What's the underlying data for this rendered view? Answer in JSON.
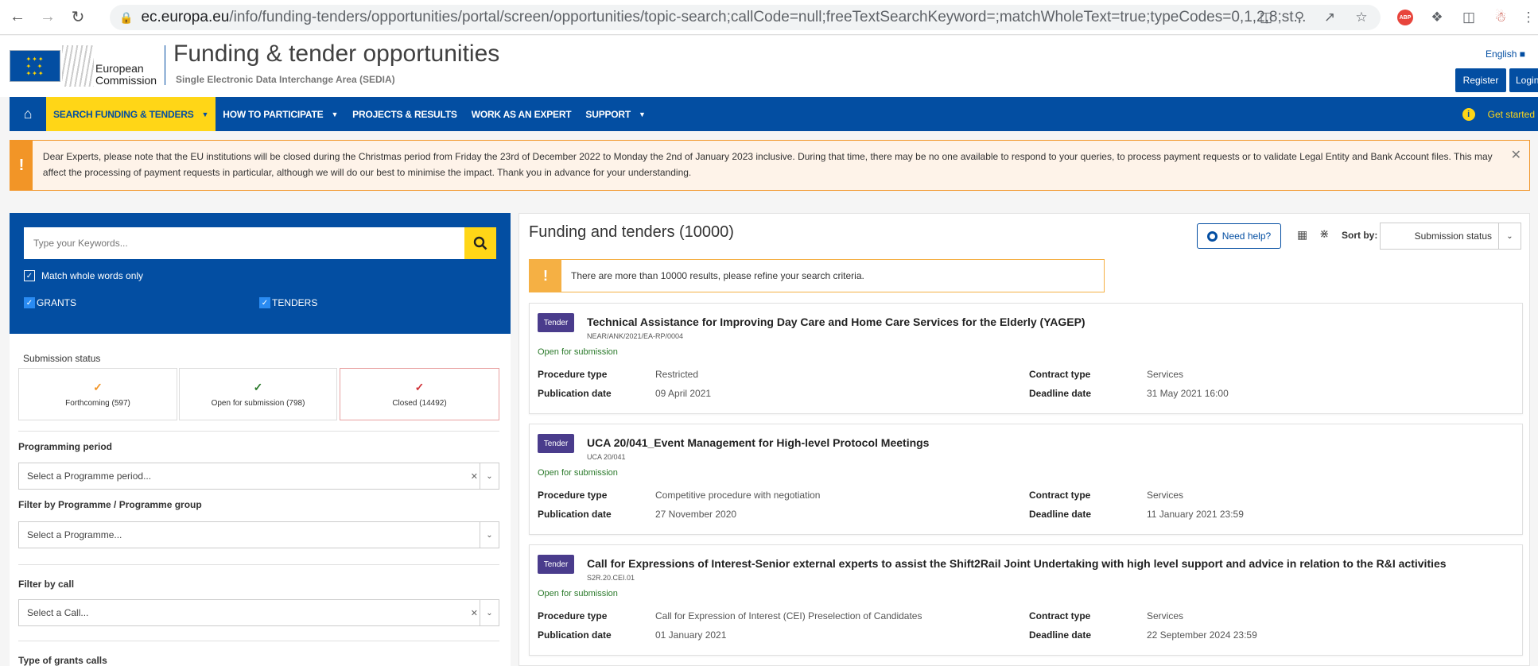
{
  "browser": {
    "url_host": "ec.europa.eu",
    "url_path": "/info/funding-tenders/opportunities/portal/screen/opportunities/topic-search;callCode=null;freeTextSearchKeyword=;matchWholeText=true;typeCodes=0,1,2,8;st...",
    "icons": [
      "back-icon",
      "forward-icon",
      "reload-icon",
      "lock-icon",
      "translate-icon",
      "zoom-icon",
      "share-icon",
      "star-icon",
      "adblock-icon",
      "extensions-icon",
      "sidepanel-icon",
      "profile-icon",
      "menu-icon"
    ]
  },
  "header": {
    "ec_line1": "European",
    "ec_line2": "Commission",
    "portal_title": "Funding & tender opportunities",
    "portal_subtitle": "Single Electronic Data Interchange Area (SEDIA)",
    "language": "English",
    "register": "Register",
    "login": "Login"
  },
  "nav": {
    "items": [
      {
        "label": "SEARCH FUNDING & TENDERS",
        "active": true,
        "caret": true
      },
      {
        "label": "HOW TO PARTICIPATE",
        "caret": true
      },
      {
        "label": "PROJECTS & RESULTS"
      },
      {
        "label": "WORK AS AN EXPERT"
      },
      {
        "label": "SUPPORT",
        "caret": true
      }
    ],
    "get_started": "Get started"
  },
  "alert": {
    "text": "Dear Experts, please note that the EU institutions will be closed during the Christmas period from Friday the 23rd of December 2022 to Monday the 2nd of January 2023 inclusive. During that time, there may be no one available to respond to your queries, to process payment requests or to validate Legal Entity and Bank Account files. This may affect the processing of payment requests in particular, although we will do our best to minimise the impact. Thank you in advance for your understanding."
  },
  "search": {
    "placeholder": "Type your Keywords...",
    "match_whole": "Match whole words only",
    "grants": "GRANTS",
    "tenders": "TENDERS"
  },
  "filters": {
    "submission_status_label": "Submission status",
    "statuses": [
      {
        "label": "Forthcoming (597)",
        "color": "#f29527"
      },
      {
        "label": "Open for submission (798)",
        "color": "#2b7a2b"
      },
      {
        "label": "Closed (14492)",
        "color": "#d0343a"
      }
    ],
    "programming_period_label": "Programming period",
    "programming_period_placeholder": "Select a Programme period...",
    "programme_label": "Filter by Programme / Programme group",
    "programme_placeholder": "Select a Programme...",
    "call_label": "Filter by call",
    "call_placeholder": "Select a Call...",
    "grant_types_label": "Type of grants calls"
  },
  "results": {
    "title": "Funding and tenders (10000)",
    "need_help": "Need help?",
    "sort_by": "Sort by:",
    "sort_value": "Submission status",
    "warning": "There are more than 10000 results, please refine your search criteria.",
    "labels": {
      "procedure_type": "Procedure type",
      "publication_date": "Publication date",
      "contract_type": "Contract type",
      "deadline_date": "Deadline date"
    },
    "items": [
      {
        "tag": "Tender",
        "title": "Technical Assistance for Improving Day Care and Home Care Services for the Elderly (YAGEP)",
        "ident": "NEAR/ANK/2021/EA-RP/0004",
        "status": "Open for submission",
        "procedure_type": "Restricted",
        "publication_date": "09 April 2021",
        "contract_type": "Services",
        "deadline_date": "31 May 2021 16:00"
      },
      {
        "tag": "Tender",
        "title": "UCA 20/041_Event Management for High-level Protocol Meetings",
        "ident": "UCA 20/041",
        "status": "Open for submission",
        "procedure_type": "Competitive procedure with negotiation",
        "publication_date": "27 November 2020",
        "contract_type": "Services",
        "deadline_date": "11 January 2021 23:59"
      },
      {
        "tag": "Tender",
        "title": "Call for Expressions of Interest-Senior external experts to assist the Shift2Rail Joint Undertaking with high level support and advice in relation to the R&I activities",
        "ident": "S2R.20.CEI.01",
        "status": "Open for submission",
        "procedure_type": "Call for Expression of Interest (CEI) Preselection of Candidates",
        "publication_date": "01 January 2021",
        "contract_type": "Services",
        "deadline_date": "22 September 2024 23:59"
      }
    ]
  }
}
